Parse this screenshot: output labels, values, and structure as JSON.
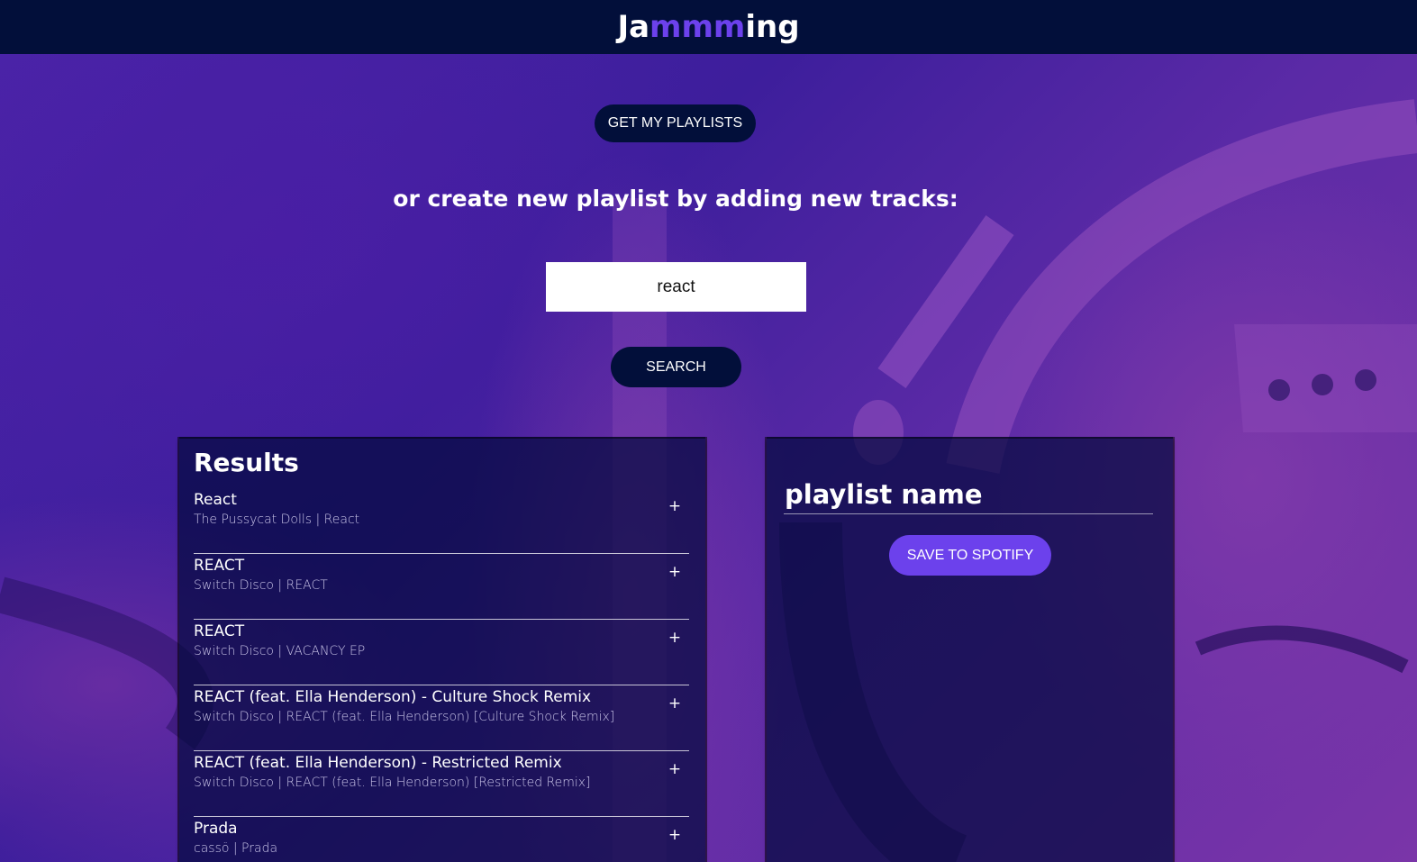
{
  "header": {
    "logo_prefix": "Ja",
    "logo_accent": "mmm",
    "logo_suffix": "ing"
  },
  "actions": {
    "get_playlists_label": "GET MY PLAYLISTS",
    "subtitle": "or create new playlist by adding new tracks:",
    "search_value": "react",
    "search_label": "SEARCH"
  },
  "results": {
    "title": "Results",
    "add_symbol": "+",
    "tracks": [
      {
        "name": "React",
        "meta": "The Pussycat Dolls | React"
      },
      {
        "name": "REACT",
        "meta": "Switch Disco | REACT"
      },
      {
        "name": "REACT",
        "meta": "Switch Disco | VACANCY EP"
      },
      {
        "name": "REACT (feat. Ella Henderson) - Culture Shock Remix",
        "meta": "Switch Disco | REACT (feat. Ella Henderson) [Culture Shock Remix]"
      },
      {
        "name": "REACT (feat. Ella Henderson) - Restricted Remix",
        "meta": "Switch Disco | REACT (feat. Ella Henderson) [Restricted Remix]"
      },
      {
        "name": "Prada",
        "meta": "cassö | Prada"
      }
    ]
  },
  "playlist": {
    "name_value": "playlist name",
    "save_label": "SAVE TO SPOTIFY"
  },
  "colors": {
    "topbar": "#020f3a",
    "accent": "#6c41ec",
    "panel": "#01083c"
  }
}
